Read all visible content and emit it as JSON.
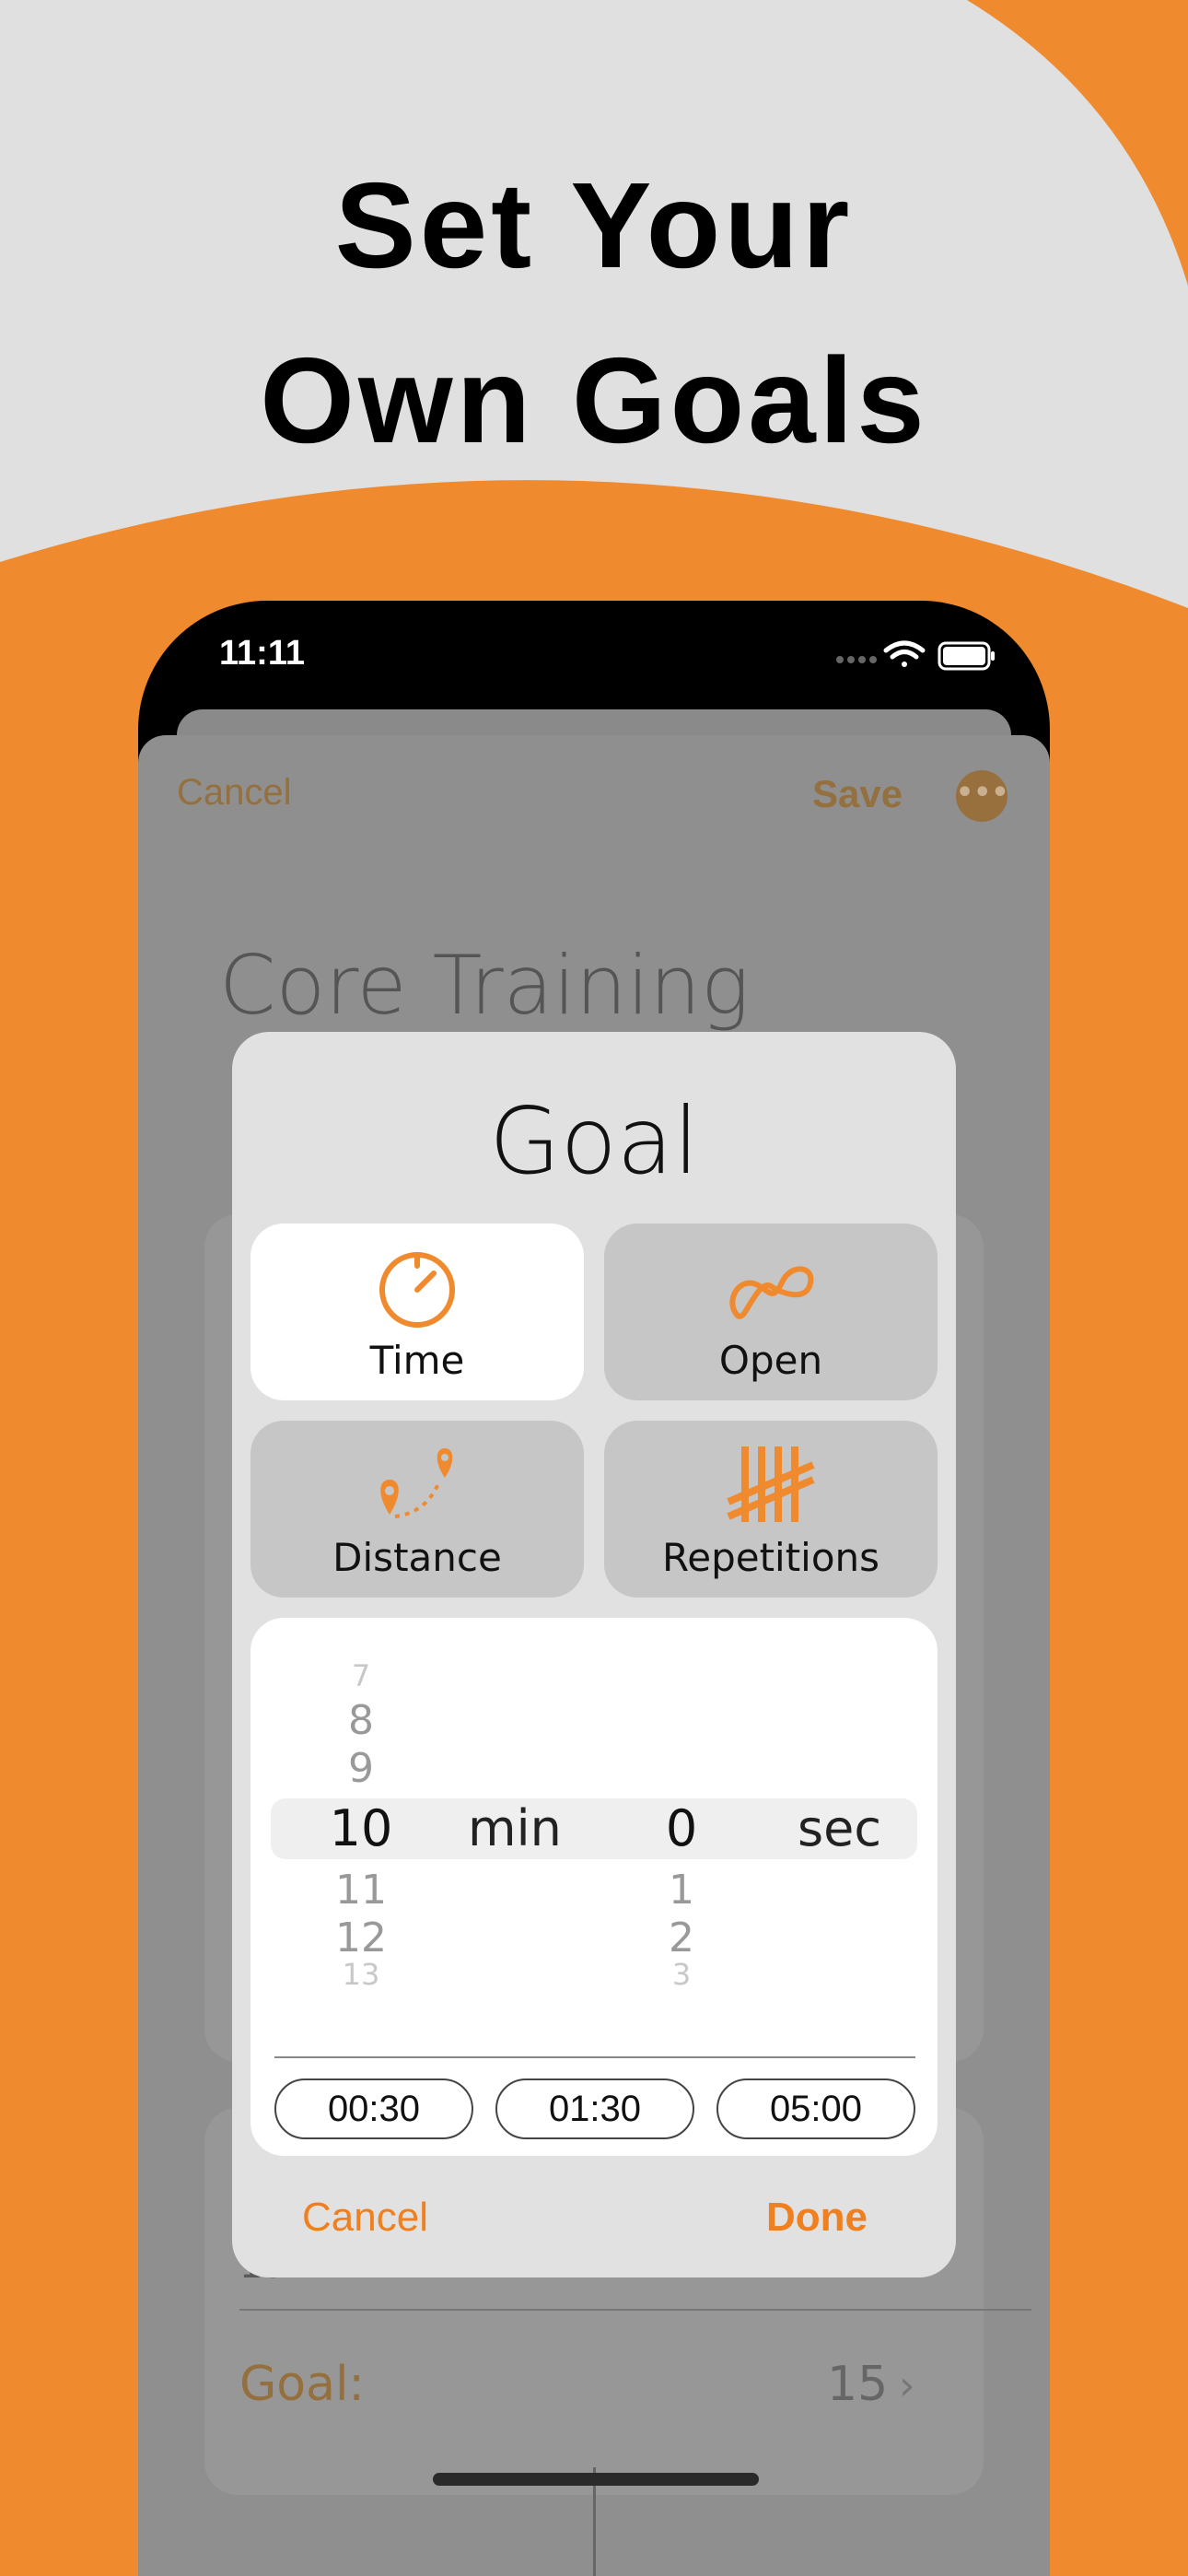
{
  "promo": {
    "headline_line1": "Set Your",
    "headline_line2": "Own Goals"
  },
  "colors": {
    "accent": "#F08A2E",
    "background": "#E0E0E0",
    "dialog": "#E1E1E1",
    "dim_sheet": "#8F8F8F"
  },
  "status_bar": {
    "time": "11:11",
    "icons": [
      "signal-dots-icon",
      "wifi-icon",
      "battery-icon"
    ]
  },
  "sheet": {
    "cancel_label": "Cancel",
    "save_label": "Save",
    "more_icon": "ellipsis-icon",
    "title": "Core Training",
    "card_value": "15",
    "goal_label": "Goal:",
    "goal_value": "15"
  },
  "dialog": {
    "title": "Goal",
    "options": [
      {
        "label": "Time",
        "icon": "stopwatch-icon",
        "selected": true
      },
      {
        "label": "Open",
        "icon": "infinity-icon",
        "selected": false
      },
      {
        "label": "Distance",
        "icon": "route-pins-icon",
        "selected": false
      },
      {
        "label": "Repetitions",
        "icon": "tally-marks-icon",
        "selected": false
      }
    ],
    "picker": {
      "minutes": {
        "above": [
          "7",
          "8",
          "9"
        ],
        "selected": "10",
        "below": [
          "11",
          "12",
          "13"
        ],
        "unit": "min"
      },
      "seconds": {
        "selected": "0",
        "below": [
          "1",
          "2",
          "3"
        ],
        "unit": "sec"
      }
    },
    "presets": [
      "00:30",
      "01:30",
      "05:00"
    ],
    "cancel_label": "Cancel",
    "done_label": "Done"
  }
}
